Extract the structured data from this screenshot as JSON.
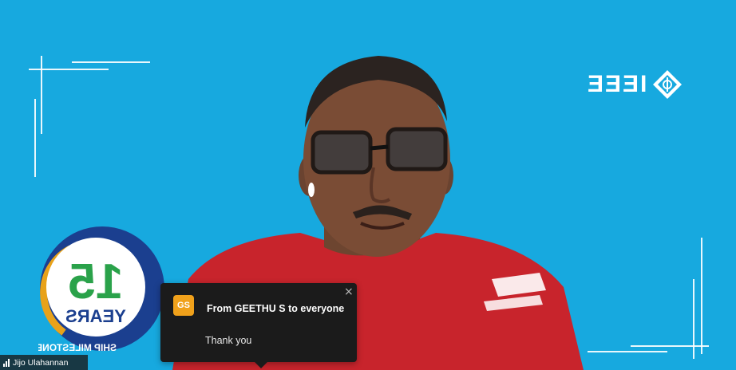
{
  "brand": {
    "logo_text": "IEEE"
  },
  "badge": {
    "number": "15",
    "years": "YEARS",
    "ring_text": "SHIP MILESTONE"
  },
  "chat": {
    "sender_initials": "GS",
    "title": "From GEETHU S to everyone",
    "message": "Thank you",
    "close_symbol": "×"
  },
  "participant": {
    "name": "Jijo Ulahannan"
  },
  "colors": {
    "background": "#17a9df",
    "chat_bg": "#1b1b1b",
    "avatar": "#f0a11b",
    "badge_green": "#2aa24a",
    "badge_gold": "#e8a21a",
    "shirt": "#c8242c"
  }
}
